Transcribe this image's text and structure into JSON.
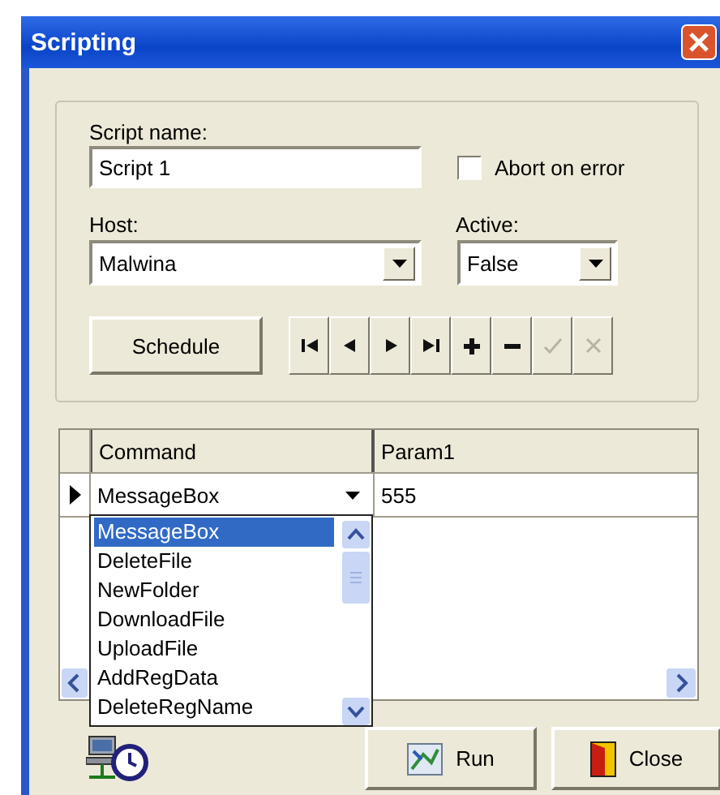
{
  "window": {
    "title": "Scripting"
  },
  "script_name": {
    "label": "Script name:",
    "value": "Script 1"
  },
  "abort_on_error": {
    "label": "Abort on error",
    "checked": false
  },
  "host": {
    "label": "Host:",
    "value": "Malwina"
  },
  "active": {
    "label": "Active:",
    "value": "False"
  },
  "schedule_button": "Schedule",
  "navigator": [
    {
      "kind": "first",
      "disabled": false
    },
    {
      "kind": "prior",
      "disabled": false
    },
    {
      "kind": "next",
      "disabled": false
    },
    {
      "kind": "last",
      "disabled": false
    },
    {
      "kind": "insert",
      "disabled": false
    },
    {
      "kind": "delete",
      "disabled": false
    },
    {
      "kind": "post",
      "disabled": true
    },
    {
      "kind": "cancel",
      "disabled": true
    }
  ],
  "table": {
    "columns": [
      "Command",
      "Param1"
    ],
    "rows": [
      {
        "command": "MessageBox",
        "param1": "555",
        "current": true
      }
    ]
  },
  "command_dropdown": [
    {
      "label": "MessageBox",
      "selected": true
    },
    {
      "label": "DeleteFile",
      "selected": false
    },
    {
      "label": "NewFolder",
      "selected": false
    },
    {
      "label": "DownloadFile",
      "selected": false
    },
    {
      "label": "UploadFile",
      "selected": false
    },
    {
      "label": "AddRegData",
      "selected": false
    },
    {
      "label": "DeleteRegName",
      "selected": false
    }
  ],
  "buttons": [
    {
      "kind": "run",
      "label": "Run"
    },
    {
      "kind": "close",
      "label": "Close"
    }
  ]
}
